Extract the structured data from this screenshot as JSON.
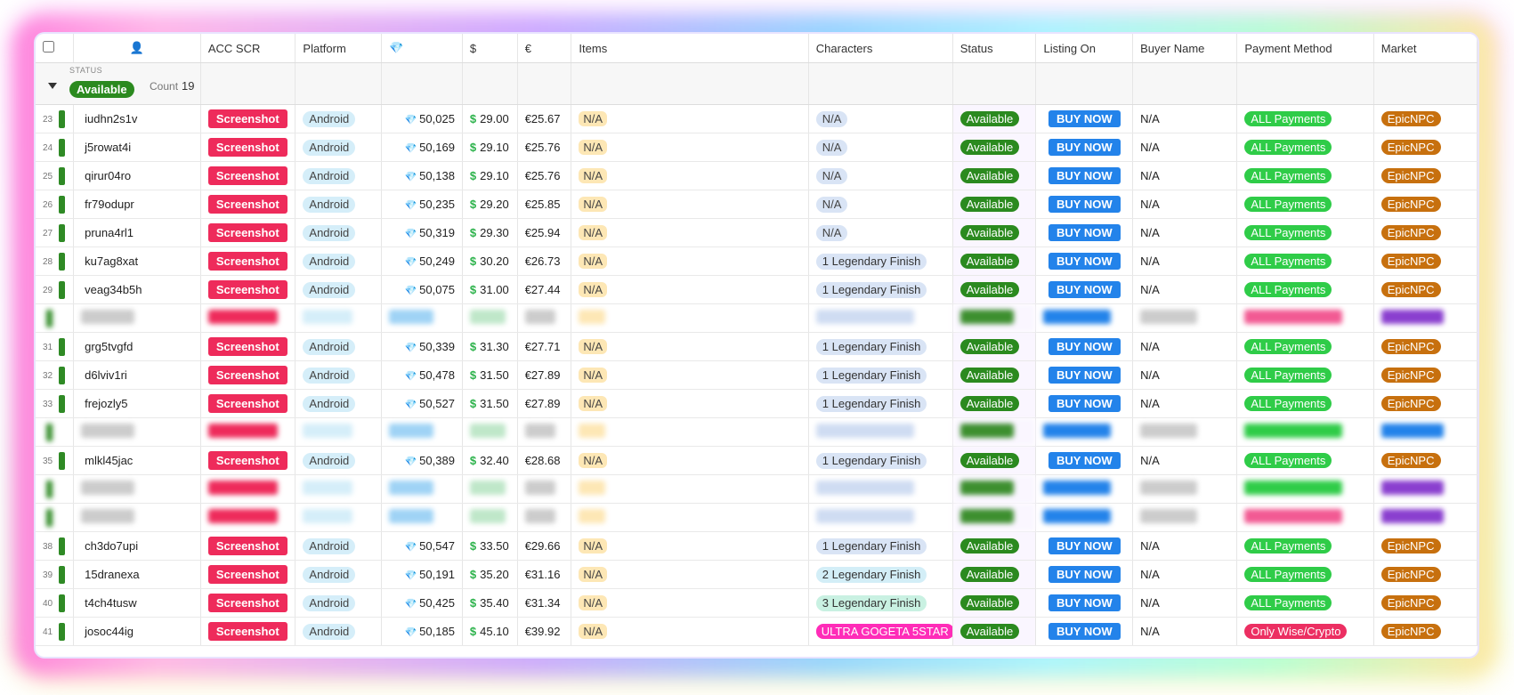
{
  "columns": [
    "",
    "👤",
    "ACC SCR",
    "Platform",
    "💎",
    "$",
    "€",
    "Items",
    "Characters",
    "Status",
    "Listing On",
    "Buyer Name",
    "Payment Method",
    "Market"
  ],
  "group": {
    "caption": "STATUS",
    "value": "Available",
    "count_label": "Count",
    "count": "19"
  },
  "rows": [
    {
      "n": "23",
      "id": "iudhn2s1v",
      "scr": "Screenshot",
      "platform": "Android",
      "gems": "50,025",
      "usd": "29.00",
      "eur": "€25.67",
      "items": "N/A",
      "chars": "N/A",
      "status": "Available",
      "listing": "BUY NOW",
      "buyer": "N/A",
      "payment": "ALL Payments",
      "market": "EpicNPC"
    },
    {
      "n": "24",
      "id": "j5rowat4i",
      "scr": "Screenshot",
      "platform": "Android",
      "gems": "50,169",
      "usd": "29.10",
      "eur": "€25.76",
      "items": "N/A",
      "chars": "N/A",
      "status": "Available",
      "listing": "BUY NOW",
      "buyer": "N/A",
      "payment": "ALL Payments",
      "market": "EpicNPC"
    },
    {
      "n": "25",
      "id": "qirur04ro",
      "scr": "Screenshot",
      "platform": "Android",
      "gems": "50,138",
      "usd": "29.10",
      "eur": "€25.76",
      "items": "N/A",
      "chars": "N/A",
      "status": "Available",
      "listing": "BUY NOW",
      "buyer": "N/A",
      "payment": "ALL Payments",
      "market": "EpicNPC"
    },
    {
      "n": "26",
      "id": "fr79odupr",
      "scr": "Screenshot",
      "platform": "Android",
      "gems": "50,235",
      "usd": "29.20",
      "eur": "€25.85",
      "items": "N/A",
      "chars": "N/A",
      "status": "Available",
      "listing": "BUY NOW",
      "buyer": "N/A",
      "payment": "ALL Payments",
      "market": "EpicNPC"
    },
    {
      "n": "27",
      "id": "pruna4rl1",
      "scr": "Screenshot",
      "platform": "Android",
      "gems": "50,319",
      "usd": "29.30",
      "eur": "€25.94",
      "items": "N/A",
      "chars": "N/A",
      "status": "Available",
      "listing": "BUY NOW",
      "buyer": "N/A",
      "payment": "ALL Payments",
      "market": "EpicNPC"
    },
    {
      "n": "28",
      "id": "ku7ag8xat",
      "scr": "Screenshot",
      "platform": "Android",
      "gems": "50,249",
      "usd": "30.20",
      "eur": "€26.73",
      "items": "N/A",
      "chars": "1 Legendary Finish",
      "status": "Available",
      "listing": "BUY NOW",
      "buyer": "N/A",
      "payment": "ALL Payments",
      "market": "EpicNPC"
    },
    {
      "n": "29",
      "id": "veag34b5h",
      "scr": "Screenshot",
      "platform": "Android",
      "gems": "50,075",
      "usd": "31.00",
      "eur": "€27.44",
      "items": "N/A",
      "chars": "1 Legendary Finish",
      "status": "Available",
      "listing": "BUY NOW",
      "buyer": "N/A",
      "payment": "ALL Payments",
      "market": "EpicNPC"
    },
    {
      "blur": true,
      "paycolor": "#f25a93",
      "marketcolor": "#8a3fcf"
    },
    {
      "n": "31",
      "id": "grg5tvgfd",
      "scr": "Screenshot",
      "platform": "Android",
      "gems": "50,339",
      "usd": "31.30",
      "eur": "€27.71",
      "items": "N/A",
      "chars": "1 Legendary Finish",
      "status": "Available",
      "listing": "BUY NOW",
      "buyer": "N/A",
      "payment": "ALL Payments",
      "market": "EpicNPC"
    },
    {
      "n": "32",
      "id": "d6lviv1ri",
      "scr": "Screenshot",
      "platform": "Android",
      "gems": "50,478",
      "usd": "31.50",
      "eur": "€27.89",
      "items": "N/A",
      "chars": "1 Legendary Finish",
      "status": "Available",
      "listing": "BUY NOW",
      "buyer": "N/A",
      "payment": "ALL Payments",
      "market": "EpicNPC"
    },
    {
      "n": "33",
      "id": "frejozly5",
      "scr": "Screenshot",
      "platform": "Android",
      "gems": "50,527",
      "usd": "31.50",
      "eur": "€27.89",
      "items": "N/A",
      "chars": "1 Legendary Finish",
      "status": "Available",
      "listing": "BUY NOW",
      "buyer": "N/A",
      "payment": "ALL Payments",
      "market": "EpicNPC"
    },
    {
      "blur": true,
      "paycolor": "#2fcc48",
      "marketcolor": "#2383ea"
    },
    {
      "n": "35",
      "id": "mlkl45jac",
      "scr": "Screenshot",
      "platform": "Android",
      "gems": "50,389",
      "usd": "32.40",
      "eur": "€28.68",
      "items": "N/A",
      "chars": "1 Legendary Finish",
      "status": "Available",
      "listing": "BUY NOW",
      "buyer": "N/A",
      "payment": "ALL Payments",
      "market": "EpicNPC"
    },
    {
      "blur": true,
      "paycolor": "#2fcc48",
      "marketcolor": "#8a3fcf"
    },
    {
      "blur": true,
      "paycolor": "#f25a93",
      "marketcolor": "#8a3fcf"
    },
    {
      "n": "38",
      "id": "ch3do7upi",
      "scr": "Screenshot",
      "platform": "Android",
      "gems": "50,547",
      "usd": "33.50",
      "eur": "€29.66",
      "items": "N/A",
      "chars": "1 Legendary Finish",
      "status": "Available",
      "listing": "BUY NOW",
      "buyer": "N/A",
      "payment": "ALL Payments",
      "market": "EpicNPC"
    },
    {
      "n": "39",
      "id": "15dranexa",
      "scr": "Screenshot",
      "platform": "Android",
      "gems": "50,191",
      "usd": "35.20",
      "eur": "€31.16",
      "items": "N/A",
      "chars": "2 Legendary Finish",
      "status": "Available",
      "listing": "BUY NOW",
      "buyer": "N/A",
      "payment": "ALL Payments",
      "market": "EpicNPC"
    },
    {
      "n": "40",
      "id": "t4ch4tusw",
      "scr": "Screenshot",
      "platform": "Android",
      "gems": "50,425",
      "usd": "35.40",
      "eur": "€31.34",
      "items": "N/A",
      "chars": "3 Legendary Finish",
      "status": "Available",
      "listing": "BUY NOW",
      "buyer": "N/A",
      "payment": "ALL Payments",
      "market": "EpicNPC"
    },
    {
      "n": "41",
      "id": "josoc44ig",
      "scr": "Screenshot",
      "platform": "Android",
      "gems": "50,185",
      "usd": "45.10",
      "eur": "€39.92",
      "items": "N/A",
      "chars": "ULTRA GOGETA 5STAR",
      "status": "Available",
      "listing": "BUY NOW",
      "buyer": "N/A",
      "payment": "Only Wise/Crypto",
      "market": "EpicNPC"
    }
  ]
}
